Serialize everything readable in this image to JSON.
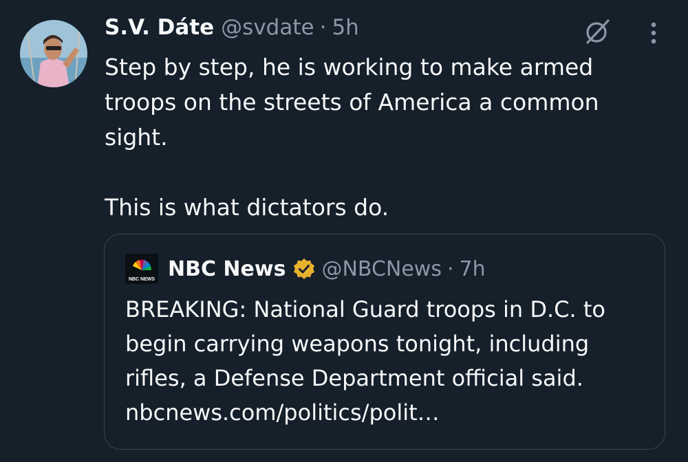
{
  "tweet": {
    "author": {
      "display_name": "S.V. Dáte",
      "handle": "@svdate",
      "separator": "·",
      "time": "5h"
    },
    "text_para1": "Step by step, he is working to make armed troops on the streets of America a common sight.",
    "text_para2": "This is what dictators do.",
    "icons": [
      "grok-icon",
      "more-options-icon",
      "avatar"
    ]
  },
  "quote": {
    "logo_text": "NBC NEWS",
    "display_name": "NBC News",
    "handle": "@NBCNews",
    "separator": "·",
    "time": "7h",
    "text": "BREAKING: National Guard troops in D.C. to begin carrying weapons tonight, including rifles, a Defense Department official said. ",
    "link": "nbcnews.com/politics/polit…",
    "verified_color": "#e8b22e"
  },
  "colors": {
    "background": "#15202b",
    "text": "#f7f9f9",
    "muted": "#8b98a5",
    "border": "#38444d"
  }
}
